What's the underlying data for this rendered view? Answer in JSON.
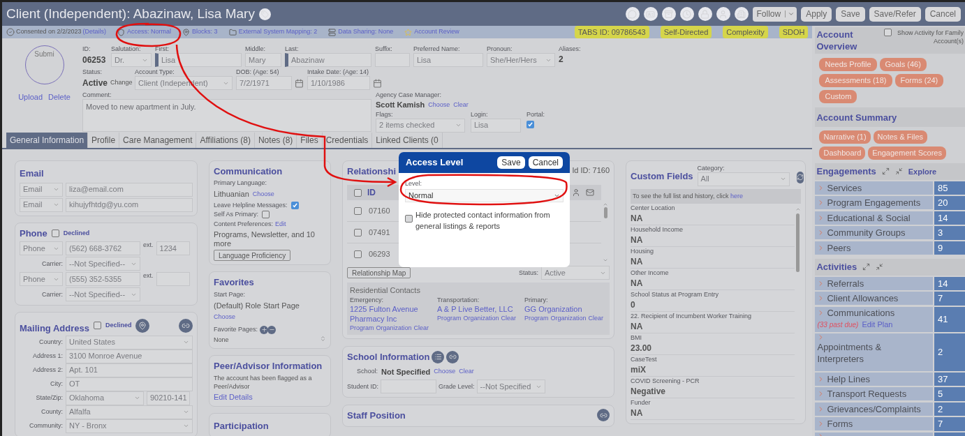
{
  "title_bar": {
    "title": "Client (Independent): Abazinaw, Lisa Mary",
    "follow": "Follow",
    "buttons": [
      "Apply",
      "Save",
      "Save/Refer",
      "Cancel"
    ]
  },
  "info_bar": {
    "consent": "Consented on 2/2/2023",
    "consent_link": "(Details)",
    "links": [
      "Access: Normal",
      "Blocks: 3",
      "External System Mapping: 2",
      "Data Sharing: None",
      "Account Review"
    ],
    "badges": [
      "TABS ID: 09786543",
      "Self-Directed",
      "Complexity",
      "SDOH"
    ]
  },
  "photo": {
    "alt": "Submi",
    "links": [
      "Upload",
      "Delete"
    ]
  },
  "identity": {
    "id_label": "ID:",
    "id": "06253",
    "status_label": "Status:",
    "status": "Active",
    "status_link": "Change",
    "row1": [
      {
        "label": "Salutation:",
        "value": "Dr.",
        "kind": "select"
      },
      {
        "label": "First:",
        "value": "Lisa",
        "kind": "required"
      },
      {
        "label": "Middle:",
        "value": "Mary",
        "kind": "input"
      },
      {
        "label": "Last:",
        "value": "Abazinaw",
        "kind": "required"
      },
      {
        "label": "Suffix:",
        "kind": "input"
      },
      {
        "label": "Preferred Name:",
        "value": "Lisa",
        "kind": "input"
      },
      {
        "label": "Pronoun:",
        "value": "She/Her/Hers",
        "kind": "select"
      },
      {
        "label": "Aliases:",
        "value": "2",
        "kind": "text"
      }
    ],
    "row2": [
      {
        "label": "Account Type:",
        "value": "Client (Independent)",
        "kind": "select"
      },
      {
        "label": "DOB: (Age: 54)",
        "value": "7/2/1971",
        "kind": "date"
      },
      {
        "label": "Intake Date: (Age: 14)",
        "value": "1/10/1986",
        "kind": "date"
      }
    ],
    "comment": {
      "label": "Comment:",
      "value": "Moved to new apartment in July."
    },
    "case_manager": {
      "label": "Agency Case Manager:",
      "name": "Scott Kamish",
      "links": [
        "Choose",
        "Clear"
      ]
    },
    "flags": {
      "label": "Flags:",
      "value": "2 items checked"
    },
    "login": {
      "label": "Login:",
      "value": "Lisa"
    },
    "portal": {
      "label": "Portal:",
      "checked": true
    }
  },
  "tabs": [
    {
      "label": "General Information",
      "selected": true
    },
    {
      "label": "Profile",
      "selected": false
    },
    {
      "label": "Care Management",
      "selected": false
    },
    {
      "label": "Affiliations (8)",
      "selected": false
    },
    {
      "label": "Notes (8)",
      "selected": false
    },
    {
      "label": "Files",
      "selected": false
    },
    {
      "label": "Credentials",
      "selected": false
    },
    {
      "label": "Linked Clients (0",
      "selected": false
    }
  ],
  "email": {
    "title": "Email",
    "rows": [
      {
        "type": "Email",
        "value": "liza@email.com"
      },
      {
        "type": "Email",
        "value": "kihujyfhtdg@yu.com"
      }
    ]
  },
  "phone": {
    "title": "Phone",
    "declined_label": "Declined",
    "declined": false,
    "rows": [
      {
        "type": "Phone",
        "value": "(562) 668-3762",
        "ext_label": "ext.",
        "ext": "1234",
        "carrier_label": "Carrier:",
        "carrier": "--Not Specified--"
      },
      {
        "type": "Phone",
        "value": "(555) 352-5355",
        "ext_label": "ext.",
        "carrier_label": "Carrier:",
        "carrier": "--Not Specified--"
      }
    ]
  },
  "mailing": {
    "title": "Mailing Address",
    "declined_label": "Declined",
    "declined": false,
    "fields": [
      {
        "label": "Country:",
        "value": "United States",
        "kind": "select"
      },
      {
        "label": "Address 1:",
        "value": "3100 Monroe Avenue",
        "kind": "input"
      },
      {
        "label": "Address 2:",
        "value": "Apt. 101",
        "kind": "input"
      },
      {
        "label": "City:",
        "value": "OT",
        "kind": "input"
      },
      {
        "label": "State/Zip:",
        "value": "Oklahoma",
        "zip": "90210-141",
        "kind": "state"
      },
      {
        "label": "County:",
        "value": "Alfalfa",
        "kind": "select"
      },
      {
        "label": "Community:",
        "value": "NY - Bronx",
        "kind": "select"
      }
    ]
  },
  "communication": {
    "title": "Communication",
    "language_label": "Primary Language:",
    "language": "Lithuanian",
    "language_link": "Choose",
    "helpline_label": "Leave Helpline Messages:",
    "helpline": true,
    "self_primary_label": "Self As Primary:",
    "self_primary": false,
    "content_label": "Content Preferences:",
    "content_link": "Edit",
    "content": "Programs, Newsletter, and 10 more",
    "button": "Language Proficiency"
  },
  "favorites": {
    "title": "Favorites",
    "start_label": "Start Page:",
    "start": "(Default) Role Start Page",
    "start_link": "Choose",
    "pages_label": "Favorite Pages:",
    "pages": "None"
  },
  "peer": {
    "title": "Peer/Advisor Information",
    "text": "The account has been flagged as a Peer/Advisor",
    "link": "Edit Details"
  },
  "participation": {
    "title": "Participation"
  },
  "relationships": {
    "title": "Relationshi",
    "household": "ld ID: 7160",
    "id_header": "ID",
    "select_all": false,
    "rows": [
      {
        "id": "07160",
        "checked": false
      },
      {
        "id": "07491",
        "checked": false
      },
      {
        "id": "06293",
        "checked": false
      }
    ],
    "map_button": "Relationship Map",
    "status_label": "Status:",
    "status": "Active",
    "residential": {
      "title": "Residential Contacts",
      "columns": [
        {
          "label": "Emergency:",
          "name": "1225 Fulton Avenue Pharmacy Inc",
          "links": [
            "Program",
            "Organization",
            "Clear"
          ]
        },
        {
          "label": "Transportation:",
          "name": "A & P Live Better, LLC",
          "links": [
            "Program",
            "Organization",
            "Clear"
          ]
        },
        {
          "label": "Primary:",
          "name": "GG Organization",
          "links": [
            "Program",
            "Organization",
            "Clear"
          ]
        }
      ]
    }
  },
  "school": {
    "title": "School Information",
    "school_label": "School:",
    "school": "Not Specified",
    "links": [
      "Choose",
      "Clear"
    ],
    "student_id_label": "Student ID:",
    "grade_label": "Grade Level:",
    "grade": "--Not Specified"
  },
  "staff": {
    "title": "Staff Position"
  },
  "custom_fields": {
    "title": "Custom Fields",
    "category_label": "Category:",
    "category": "All",
    "note": "To see the full list and history, click",
    "note_link": "here",
    "items": [
      {
        "label": "Center Location",
        "value": "NA"
      },
      {
        "label": "Household Income",
        "value": "NA"
      },
      {
        "label": "Housing",
        "value": "NA"
      },
      {
        "label": "Other Income",
        "value": "NA"
      },
      {
        "label": "School Status at Program Entry",
        "value": "0"
      },
      {
        "label": "22. Recipient of Incumbent Worker Training",
        "value": "NA"
      },
      {
        "label": "BMI",
        "value": "23.00"
      },
      {
        "label": "CaseTest",
        "value": "miX"
      },
      {
        "label": "COVID Screening - PCR",
        "value": "Negative"
      },
      {
        "label": "Funder",
        "value": "NA"
      }
    ]
  },
  "sidebar": {
    "overview": {
      "title": "Account Overview",
      "family_label": "Show Activity for Family Account(s)",
      "family": false,
      "pills": [
        "Needs Profile",
        "Goals (46)",
        "Assessments (18)",
        "Forms (24)",
        "Custom"
      ]
    },
    "summary": {
      "title": "Account Summary",
      "pills": [
        "Narrative (1)",
        "Notes & Files",
        "Dashboard",
        "Engagement Scores"
      ]
    },
    "engagements": {
      "title": "Engagements",
      "link": "Explore",
      "items": [
        {
          "label": "Services",
          "count": "85"
        },
        {
          "label": "Program Engagements",
          "count": "20"
        },
        {
          "label": "Educational & Social",
          "count": "14"
        },
        {
          "label": "Community Groups",
          "count": "3"
        },
        {
          "label": "Peers",
          "count": "9"
        }
      ]
    },
    "activities": {
      "title": "Activities",
      "items": [
        {
          "label": "Referrals",
          "count": "14"
        },
        {
          "label": "Client Allowances",
          "count": "7"
        },
        {
          "label": "Communications",
          "note": "(33 past due)",
          "link": "Edit Plan",
          "count": "41"
        },
        {
          "label": "Appointments & Interpreters",
          "count": "2",
          "kind": "wrapped"
        },
        {
          "label": "Help Lines",
          "count": "37"
        },
        {
          "label": "Transport Requests",
          "count": "5"
        },
        {
          "label": "Grievances/Complaints",
          "count": "2"
        },
        {
          "label": "Forms",
          "count": "7"
        },
        {
          "kind": "cut"
        }
      ]
    }
  },
  "modal": {
    "title": "Access Level",
    "buttons": [
      "Save",
      "Cancel"
    ],
    "level_label": "Level:",
    "level": "Normal",
    "hide_label": "Hide protected contact information from general listings & reports",
    "hide": false
  }
}
